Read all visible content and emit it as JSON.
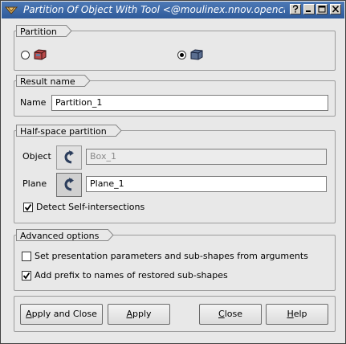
{
  "window": {
    "title": "Partition Of Object With Tool <@moulinex.nnov.openca",
    "accent_color": "#3a66a6"
  },
  "partition": {
    "title": "Partition",
    "options": [
      {
        "icon": "partition-solid-icon",
        "selected": false
      },
      {
        "icon": "partition-halfspace-icon",
        "selected": true
      }
    ]
  },
  "result": {
    "title": "Result name",
    "name_label": "Name",
    "name_value": "Partition_1"
  },
  "halfspace": {
    "title": "Half-space partition",
    "object_label": "Object",
    "object_value": "Box_1",
    "plane_label": "Plane",
    "plane_value": "Plane_1",
    "detect_label": "Detect Self-intersections",
    "detect_checked": true
  },
  "advanced": {
    "title": "Advanced options",
    "set_presentation_label": "Set presentation parameters and sub-shapes from arguments",
    "set_presentation_checked": false,
    "add_prefix_label": "Add prefix to names of restored sub-shapes",
    "add_prefix_checked": true
  },
  "buttons": {
    "apply_close": {
      "pre": "",
      "mn": "A",
      "post": "pply and Close"
    },
    "apply": {
      "pre": "",
      "mn": "A",
      "post": "pply"
    },
    "close": {
      "pre": "",
      "mn": "C",
      "post": "lose"
    },
    "help": {
      "pre": "",
      "mn": "H",
      "post": "elp"
    }
  }
}
